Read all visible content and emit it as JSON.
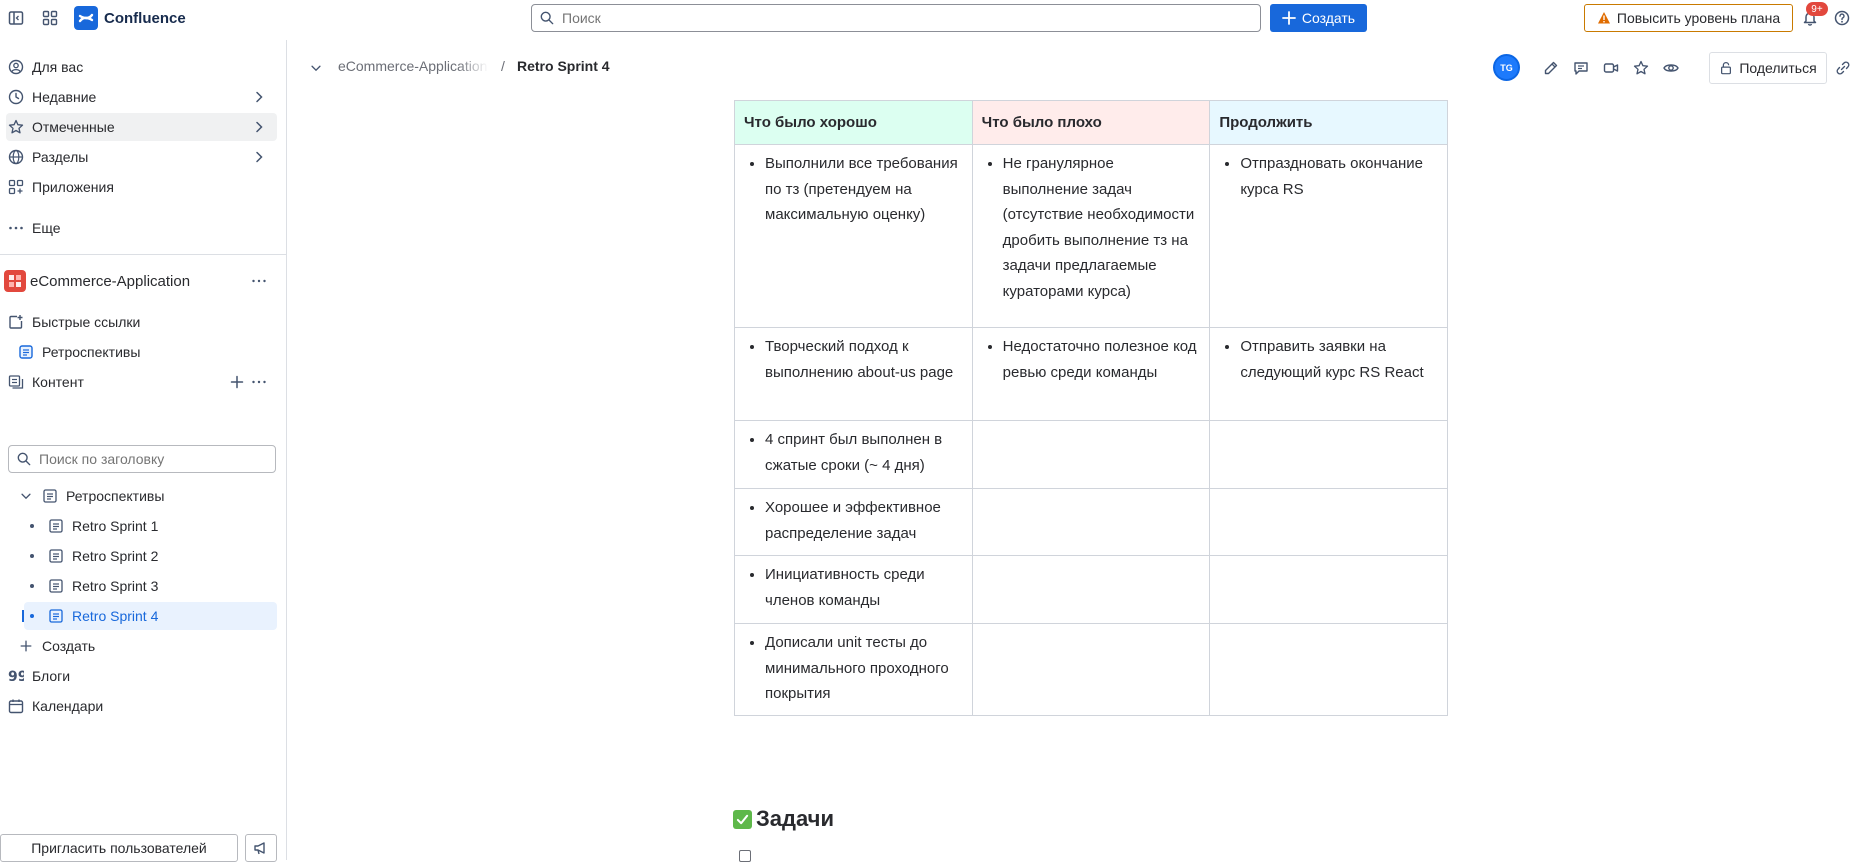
{
  "topbar": {
    "app_name": "Confluence",
    "search_placeholder": "Поиск",
    "create_label": "Создать",
    "upgrade_label": "Повысить уровень плана",
    "notifications_badge": "9+"
  },
  "sidebar": {
    "nav": [
      {
        "label": "Для вас"
      },
      {
        "label": "Недавние"
      },
      {
        "label": "Отмеченные"
      },
      {
        "label": "Разделы"
      },
      {
        "label": "Приложения"
      },
      {
        "label": "Еще"
      }
    ],
    "space_name": "eCommerce-Application",
    "quick_links": "Быстрые ссылки",
    "retro_shortcut": "Ретроспективы",
    "content_label": "Контент",
    "search_placeholder": "Поиск по заголовку",
    "tree": {
      "parent": "Ретроспективы",
      "children": [
        "Retro Sprint 1",
        "Retro Sprint 2",
        "Retro Sprint 3",
        "Retro Sprint 4"
      ]
    },
    "create_label": "Создать",
    "blogs": "Блоги",
    "calendars": "Календари",
    "invite": "Пригласить пользователей"
  },
  "page": {
    "breadcrumb_space": "eCommerce-Application",
    "breadcrumb_sep": "/",
    "breadcrumb_current": "Retro Sprint 4",
    "avatar_initials": "TG",
    "share_label": "Поделиться"
  },
  "table": {
    "headers": [
      "Что было хорошо",
      "Что было плохо",
      "Продолжить"
    ],
    "header_colors": [
      "#dcfff1",
      "#ffeceb",
      "#e7f8ff"
    ],
    "rows": [
      [
        "Выполнили все требования по тз (претендуем на максимальную оценку)",
        "Не гранулярное выполнение задач (отсутствие необходимости дробить выполнение тз на задачи предлагаемые кураторами курса)",
        "Отпраздновать окончание курса RS"
      ],
      [
        "Творческий подход к выполнению about-us page",
        "Недостаточно полезное код ревью среди команды",
        "Отправить заявки на следующий курс RS React"
      ],
      [
        "4 спринт был выполнен в сжатые сроки (~ 4 дня)",
        "",
        ""
      ],
      [
        "Хорошее и эффективное распределение задач",
        "",
        ""
      ],
      [
        "Инициативность среди членов команды",
        "",
        ""
      ],
      [
        "Дописали unit тесты до минимального проходного покрытия",
        "",
        ""
      ]
    ]
  },
  "tasks": {
    "title": "Задачи"
  },
  "colors": {
    "accent": "#1868db",
    "upgrade_border": "#c97a00",
    "badge": "#e2483d"
  }
}
